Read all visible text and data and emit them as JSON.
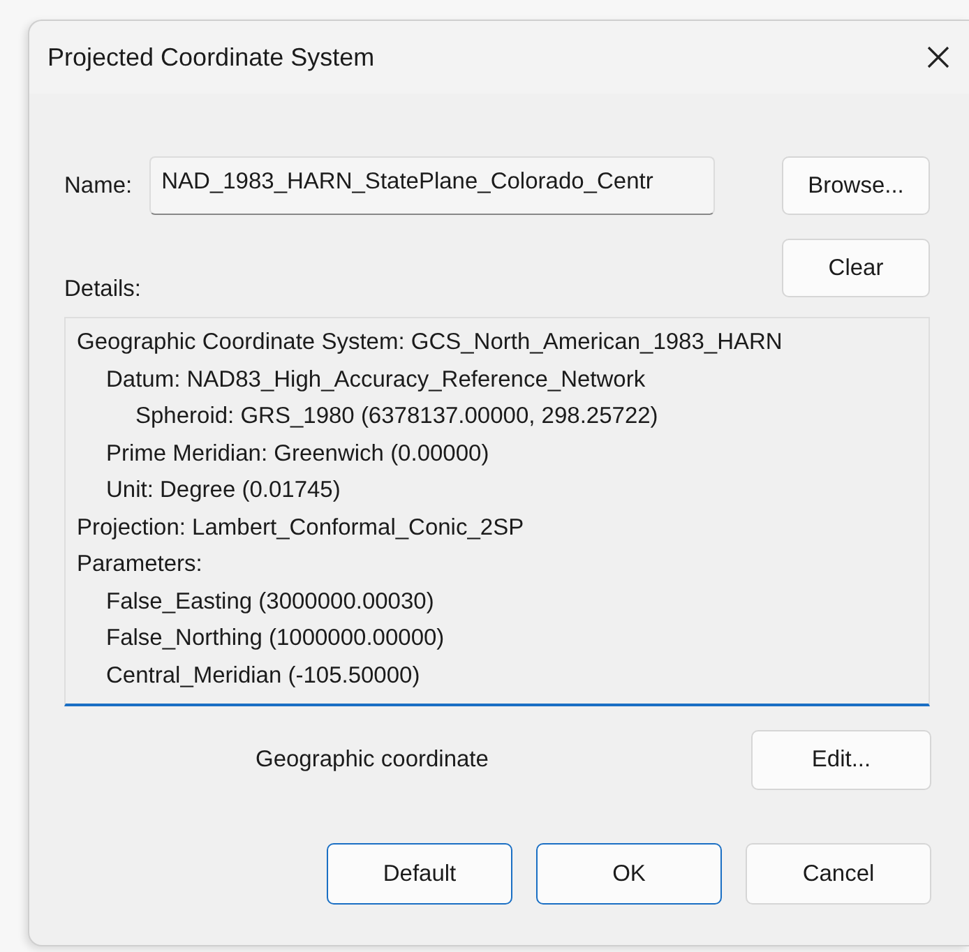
{
  "window": {
    "title": "Projected Coordinate System"
  },
  "name": {
    "label": "Name:",
    "value": "NAD_1983_HARN_StatePlane_Colorado_Centr"
  },
  "side_buttons": [
    "Browse...",
    "Clear"
  ],
  "details": {
    "label": "Details:",
    "lines": [
      {
        "text": "Geographic Coordinate System: GCS_North_American_1983_HARN",
        "children": [
          {
            "text": "Datum: NAD83_High_Accuracy_Reference_Network",
            "children": [
              {
                "text": "Spheroid: GRS_1980 (6378137.00000, 298.25722)"
              }
            ]
          },
          {
            "text": "Prime Meridian: Greenwich (0.00000)"
          },
          {
            "text": "Unit: Degree (0.01745)"
          }
        ]
      },
      {
        "text": "Projection: Lambert_Conformal_Conic_2SP"
      },
      {
        "text": "Parameters:",
        "children": [
          {
            "text": "False_Easting (3000000.00030)"
          },
          {
            "text": "False_Northing (1000000.00000)"
          },
          {
            "text": "Central_Meridian (-105.50000)"
          }
        ]
      }
    ]
  },
  "geographic": {
    "label": "Geographic coordinate",
    "button": "Edit..."
  },
  "buttons": [
    {
      "label": "Default",
      "focused": true
    },
    {
      "label": "OK",
      "focused": true
    },
    {
      "label": "Cancel",
      "focused": false
    }
  ]
}
